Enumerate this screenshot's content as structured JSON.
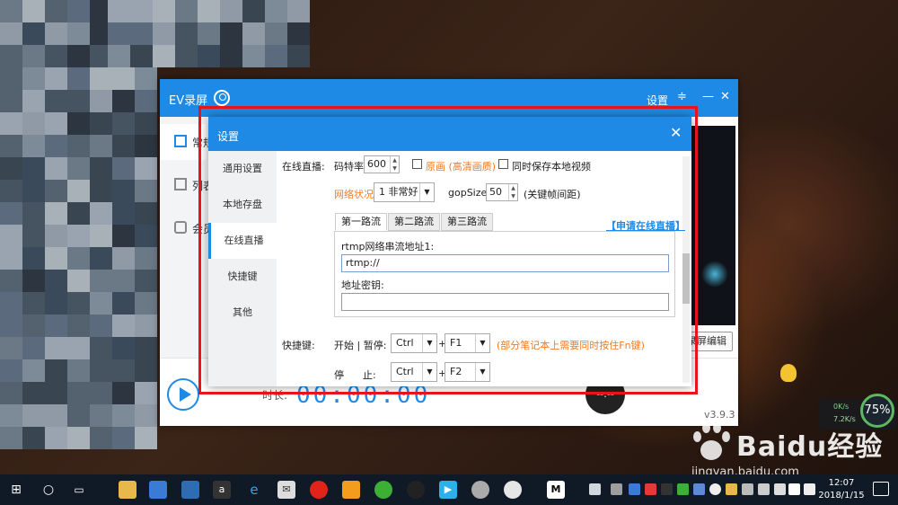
{
  "ev_window": {
    "title": "EV录屏",
    "settings_label": "设置",
    "sidebar_items": [
      "常规",
      "列表",
      "会员"
    ],
    "record_edit_label": "录屏编辑",
    "timer": "00:00:00",
    "duration_label": "时长:",
    "round_button_label": "--:--",
    "version": "v3.9.3"
  },
  "dialog": {
    "title": "设置",
    "close_glyph": "✕",
    "nav": [
      "通用设置",
      "本地存盘",
      "在线直播",
      "快捷键",
      "其他"
    ],
    "active_nav": "在线直播",
    "live": {
      "section_label": "在线直播:",
      "bitrate_label": "码特率:",
      "bitrate_value": "600",
      "hd_label": "原画 (高清画质)",
      "save_local_label": "同时保存本地视频",
      "network_label": "网络状况:",
      "network_value": "1  非常好",
      "gop_label": "gopSize:",
      "gop_value": "50",
      "gop_note": "(关键帧间距)",
      "apply_link": "【申请在线直播】",
      "tabs": [
        "第一路流",
        "第二路流",
        "第三路流"
      ],
      "rtmp_label": "rtmp网络串流地址1:",
      "rtmp_value": "rtmp://",
      "key_label": "地址密钥:",
      "key_value": ""
    },
    "hotkeys": {
      "section_label": "快捷键:",
      "start_pause_label": "开始 | 暂停:",
      "start_mod": "Ctrl",
      "start_key": "F1",
      "plus": "+",
      "note": "(部分笔记本上需要同时按住Fn键)",
      "stop_label": "停      止:",
      "stop_mod": "Ctrl",
      "stop_key": "F2"
    }
  },
  "widgets": {
    "net_up": "0K/s",
    "net_down": "7.2K/s",
    "cpu_percent": "75%"
  },
  "watermark": {
    "brand": "Bai\u0000du经验",
    "brand_text": "Baidu经验",
    "url": "jingyan.baidu.com"
  },
  "taskbar": {
    "time": "12:07",
    "date": "2018/1/15"
  },
  "colors": {
    "accent": "#1e8ae6",
    "warning": "#f07a24",
    "highlight": "#e8141c"
  }
}
